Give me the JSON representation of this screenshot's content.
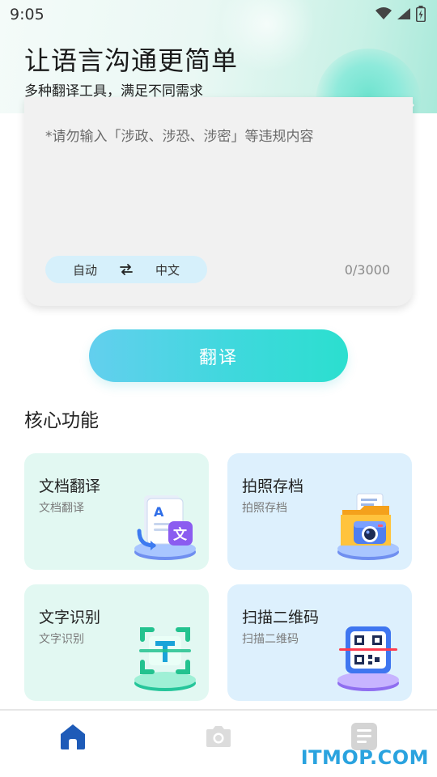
{
  "status_bar": {
    "time": "9:05"
  },
  "hero": {
    "title": "让语言沟通更简单",
    "subtitle": "多种翻译工具，满足不同需求"
  },
  "input": {
    "placeholder": "*请勿输入「涉政、涉恐、涉密」等违规内容",
    "source_lang": "自动",
    "target_lang": "中文",
    "char_count": "0/3000"
  },
  "translate_button": {
    "label": "翻译"
  },
  "features": {
    "title": "核心功能",
    "items": [
      {
        "title": "文档翻译",
        "subtitle": "文档翻译"
      },
      {
        "title": "拍照存档",
        "subtitle": "拍照存档"
      },
      {
        "title": "文字识别",
        "subtitle": "文字识别"
      },
      {
        "title": "扫描二维码",
        "subtitle": "扫描二维码"
      }
    ]
  },
  "watermark": {
    "text": "ITMOP.COM"
  },
  "colors": {
    "accent_start": "#63cfee",
    "accent_end": "#2bdfcf",
    "nav_active": "#1e5bb8",
    "nav_inactive": "#d9d9d9"
  }
}
